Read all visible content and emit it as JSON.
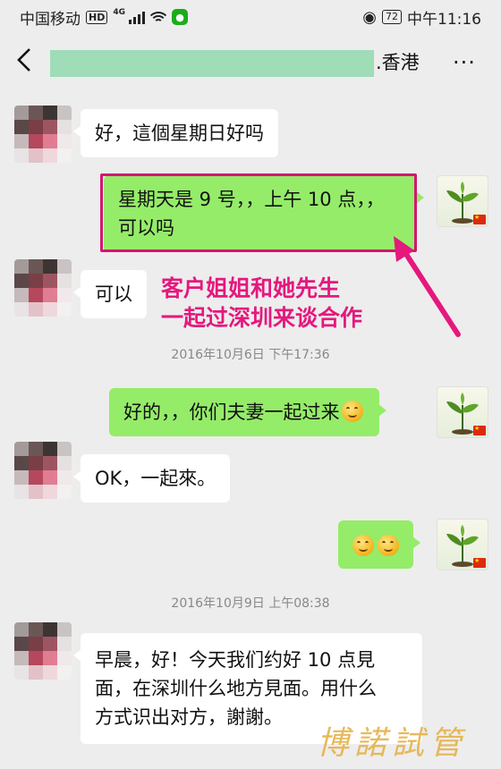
{
  "status_bar": {
    "carrier": "中国移动",
    "hd_badge": "HD",
    "network": "4G",
    "battery": "72",
    "time": "中午11:16"
  },
  "header": {
    "title_suffix": ".香港",
    "more_label": "···"
  },
  "messages": [
    {
      "side": "in",
      "text": "好，這個星期日好吗"
    },
    {
      "side": "out",
      "line1": "星期天是 9 号，，上午 10 点，，",
      "line2": "可以吗"
    },
    {
      "side": "in",
      "text": "可以"
    },
    {
      "side": "out",
      "text": "好的，，你们夫妻一起过来",
      "emoji": "smile-emoji"
    },
    {
      "side": "in",
      "text": "OK，一起來。"
    },
    {
      "side": "out",
      "emoji_count": 2
    },
    {
      "side": "in",
      "line1": "早晨，好！今天我们约好 10 点見",
      "line2": "面，在深圳什么地方見面。用什么",
      "line3": "方式识出对方，謝謝。"
    }
  ],
  "timestamps": [
    "2016年10月6日 下午17:36",
    "2016年10月9日 上午08:38"
  ],
  "annotation": {
    "line1": "客户姐姐和她先生",
    "line2": "一起过深圳来谈合作",
    "color": "#e5187d"
  },
  "watermark": "博諾試管",
  "colors": {
    "background": "#ededed",
    "outgoing_bubble": "#95ec69",
    "incoming_bubble": "#ffffff",
    "redaction": "#9fdcb8"
  }
}
